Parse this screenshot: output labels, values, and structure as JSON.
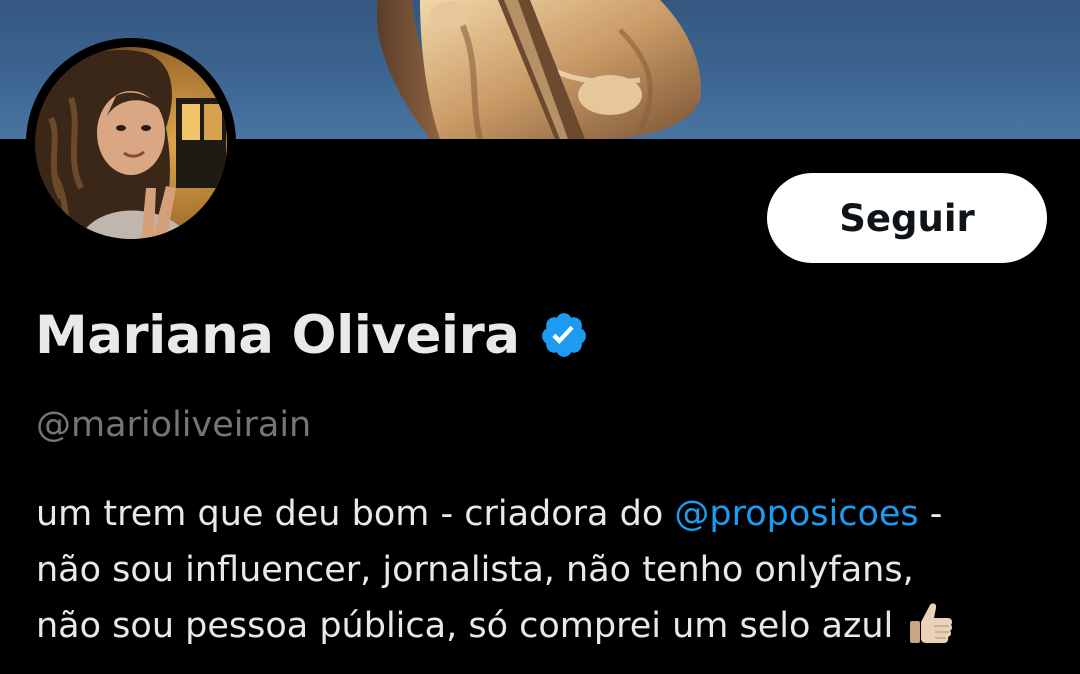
{
  "profile": {
    "display_name": "Mariana Oliveira",
    "handle": "@marioliveirain",
    "follow_label": "Seguir",
    "bio": {
      "line1_text": "um trem que deu bom - criadora do ",
      "mention": "@proposicoes",
      "line1_suffix": " -",
      "line2": "não sou influencer, jornalista, não tenho onlyfans,",
      "line3": "não sou pessoa pública, só comprei um selo azul"
    },
    "verified": true
  },
  "icons": {
    "verified": "verified-badge-icon",
    "bio_emoji": "thumbs-up-emoji"
  },
  "colors": {
    "background": "#000000",
    "primary_text": "#e7e9ea",
    "secondary_text": "#71767b",
    "link": "#1d9bf0",
    "verified_blue": "#1d9bf0",
    "button_bg": "#ffffff",
    "button_text": "#0f1419"
  }
}
